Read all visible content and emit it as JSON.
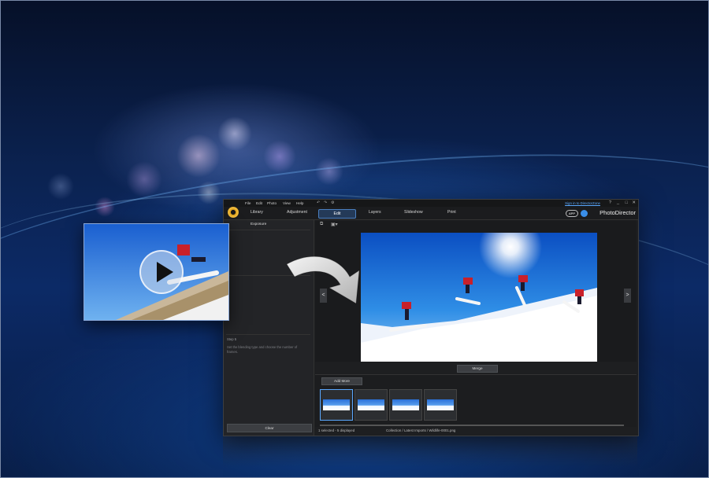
{
  "menu": [
    "File",
    "Edit",
    "Photo",
    "View",
    "Help"
  ],
  "signin_label": "Sign in to DirectorZone",
  "window_controls": [
    "?",
    "_",
    "□",
    "✕"
  ],
  "tabs": {
    "library": "Library",
    "adjustment": "Adjustment",
    "edit": "Edit",
    "layers": "Layers",
    "slideshow": "Slideshow",
    "print": "Print"
  },
  "app_badge": "APP",
  "brand": "PhotoDirector",
  "left_panel": {
    "title": "Exposure",
    "clear_label": "Clear",
    "step5_title": "Step 5",
    "step5_text": "Set the blending type and choose the number of frames."
  },
  "merge_label": "Merge",
  "add_more_label": "Add More",
  "thumbnails": [
    {
      "selected": true
    },
    {
      "selected": false
    },
    {
      "selected": false
    },
    {
      "selected": false
    }
  ],
  "status": {
    "selection": "1 selected - 5 displayed",
    "path": "Collection / Latest Imports / Wildlife-0001.png"
  },
  "icons": {
    "play": "play-icon",
    "arrow": "curved-arrow-icon",
    "prev": "chevron-left-icon",
    "next": "chevron-right-icon"
  },
  "nav": {
    "prev": "<",
    "next": ">"
  },
  "colors": {
    "accent": "#4a7fc0",
    "link": "#59a8ff",
    "background": "#0b2250"
  }
}
